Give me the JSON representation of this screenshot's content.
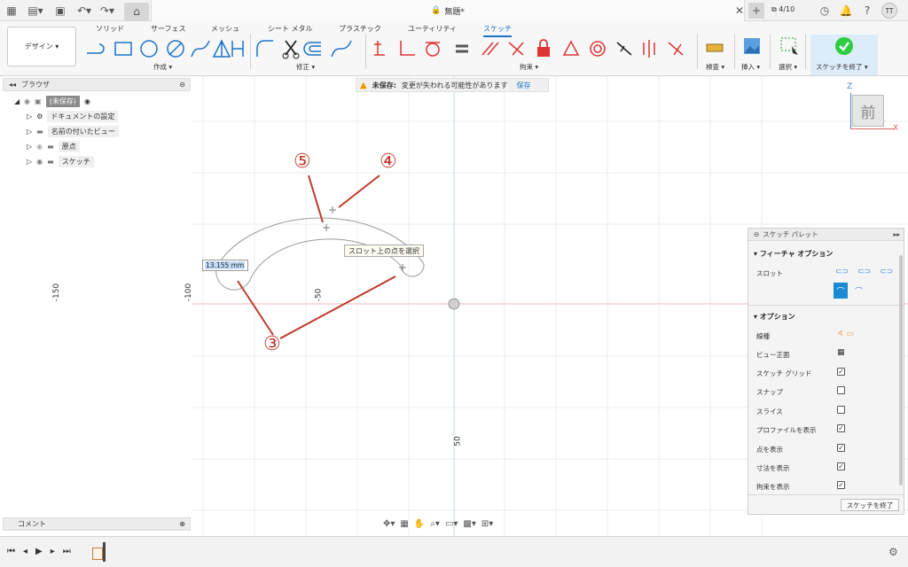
{
  "titlebar": {
    "doc_title": "無題*",
    "job_count": "4/10",
    "user_initials": "TT"
  },
  "tabs": [
    "ソリッド",
    "サーフェス",
    "メッシュ",
    "シート メタル",
    "プラスチック",
    "ユーティリティ",
    "スケッチ"
  ],
  "workspace": {
    "label": "デザイン ▾"
  },
  "groups": {
    "create": "作成 ▾",
    "modify": "修正 ▾",
    "constraints": "拘束 ▾",
    "inspect": "検査 ▾",
    "insert": "挿入 ▾",
    "select": "選択 ▾",
    "finish": "スケッチを終了 ▾"
  },
  "browser": {
    "title": "ブラウザ",
    "items": [
      "(未保存)",
      "ドキュメントの設定",
      "名前の付いたビュー",
      "原点",
      "スケッチ"
    ]
  },
  "warning": {
    "label": "未保存:",
    "message": "変更が失われる可能性があります",
    "save": "保存"
  },
  "canvas": {
    "axis_labels": [
      "-150",
      "-100",
      "-50",
      "50"
    ],
    "callouts": [
      "⑤",
      "④",
      "③"
    ],
    "tooltip": "スロット上の点を選択",
    "dimension_value": "13.155 mm",
    "viewcube_face": "前",
    "axis_z": "Z",
    "axis_x": "X"
  },
  "palette": {
    "title": "スケッチ パレット",
    "feature_options": "フィーチャ オプション",
    "slot_label": "スロット",
    "options_title": "オプション",
    "rows": [
      {
        "label": "線種",
        "checked": null
      },
      {
        "label": "ビュー正面",
        "checked": null
      },
      {
        "label": "スケッチ グリッド",
        "checked": true
      },
      {
        "label": "スナップ",
        "checked": false
      },
      {
        "label": "スライス",
        "checked": false
      },
      {
        "label": "プロファイルを表示",
        "checked": true
      },
      {
        "label": "点を表示",
        "checked": true
      },
      {
        "label": "寸法を表示",
        "checked": true
      },
      {
        "label": "拘束を表示",
        "checked": true
      }
    ],
    "finish_button": "スケッチを終了"
  },
  "comment": {
    "label": "コメント"
  },
  "colors": {
    "accent": "#1a73c8",
    "finish_green": "#2ecc40",
    "constraint_red": "#d33",
    "callout_red": "#c0392b"
  }
}
